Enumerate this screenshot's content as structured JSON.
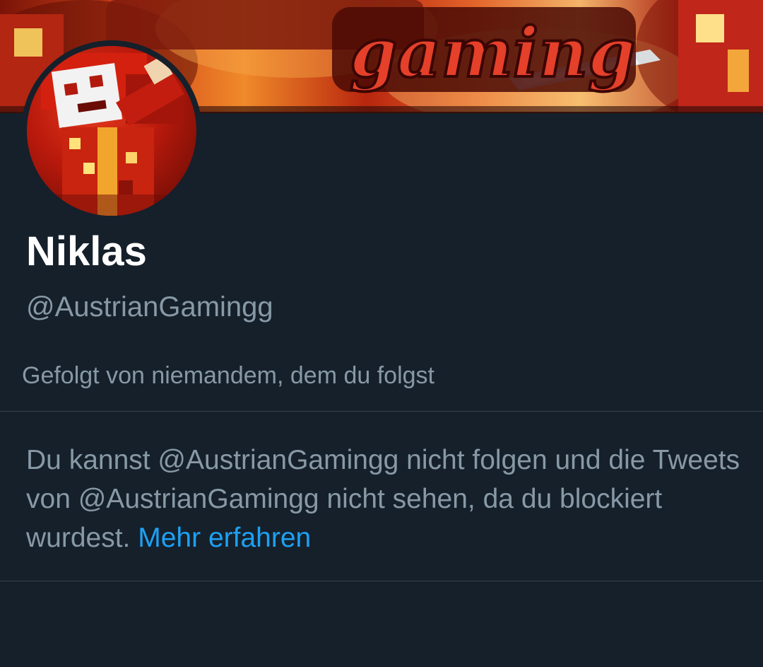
{
  "profile": {
    "banner_text": "gaming",
    "display_name": "Niklas",
    "handle": "@AustrianGamingg",
    "followed_by": "Gefolgt von niemandem, dem du folgst"
  },
  "blocked_notice": {
    "text": "Du kannst @AustrianGamingg nicht folgen und die Tweets von @AustrianGamingg nicht sehen, da du blockiert wurdest.",
    "learn_more_label": "Mehr erfahren"
  },
  "colors": {
    "background": "#15202b",
    "secondary_text": "#8899a6",
    "link": "#1da1f2",
    "divider": "#38444d"
  }
}
